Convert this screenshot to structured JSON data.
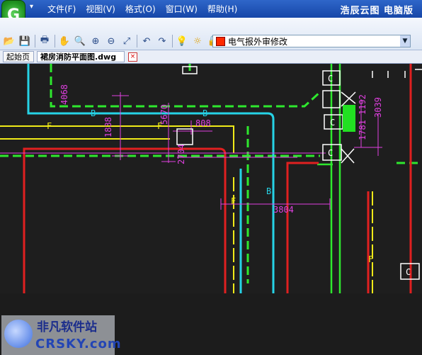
{
  "app": {
    "logo_letter": "G",
    "title": "浩辰云图 电脑版",
    "system_menu_glyph": "▾"
  },
  "menu": {
    "items": [
      "文件(F)",
      "视图(V)",
      "格式(O)",
      "窗口(W)",
      "帮助(H)"
    ]
  },
  "toolbar": {
    "icons": [
      "open-icon",
      "save-icon",
      "print-icon",
      "pan-icon",
      "zoom-window-icon",
      "zoom-in-icon",
      "zoom-out-icon",
      "zoom-extents-icon",
      "undo-icon",
      "redo-icon",
      "lightbulb-icon",
      "sun-icon",
      "lock-icon"
    ],
    "layer": {
      "name": "电气报外审修改",
      "color": "#ff2a00"
    }
  },
  "tabs": [
    {
      "label": "起始页"
    },
    {
      "label": "裙房消防平面图.dwg"
    }
  ],
  "tab_close": "×",
  "drawing": {
    "dimensions": [
      "4068",
      "1838",
      "5670",
      "808",
      "3039",
      "1192",
      "1781",
      "2704",
      "3804"
    ],
    "labels": [
      "B",
      "B",
      "F",
      "F",
      "F",
      "B",
      "F",
      "C",
      "C",
      "C",
      "C"
    ]
  },
  "watermark": {
    "line1": "非凡软件站",
    "line2": "CRSKY.com"
  }
}
